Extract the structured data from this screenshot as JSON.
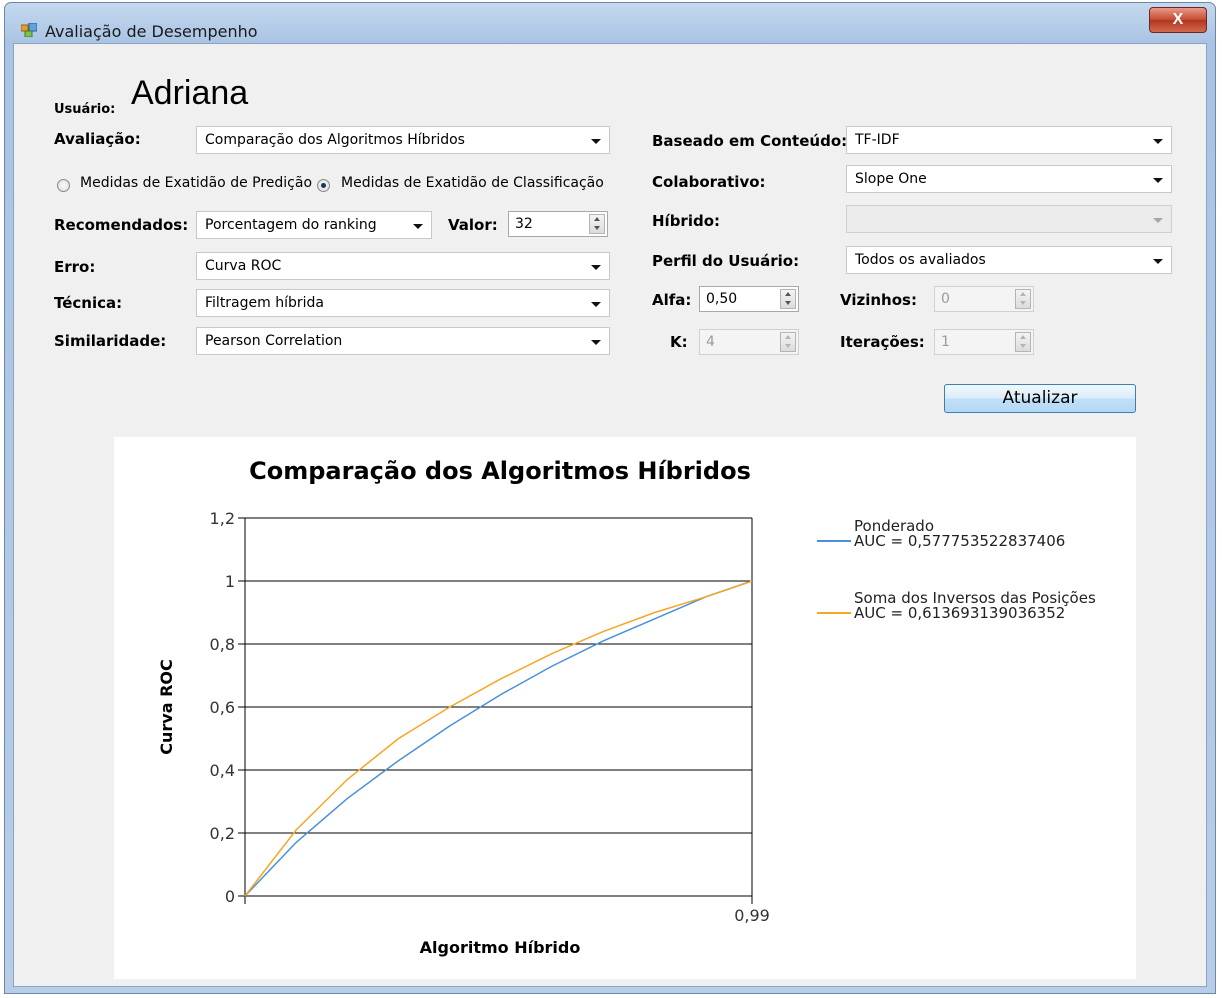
{
  "window": {
    "title": "Avaliação de Desempenho",
    "close_label": "X"
  },
  "user": {
    "label": "Usuário:",
    "name": "Adriana"
  },
  "left": {
    "avaliacao_label": "Avaliação:",
    "avaliacao_value": "Comparação dos Algoritmos Híbridos",
    "radio1_label": "Medidas de Exatidão de Predição",
    "radio2_label": "Medidas de Exatidão de Classificação",
    "recomendados_label": "Recomendados:",
    "recomendados_value": "Porcentagem do ranking",
    "valor_label": "Valor:",
    "valor_value": "32",
    "erro_label": "Erro:",
    "erro_value": "Curva ROC",
    "tecnica_label": "Técnica:",
    "tecnica_value": "Filtragem híbrida",
    "similaridade_label": "Similaridade:",
    "similaridade_value": "Pearson Correlation"
  },
  "right": {
    "conteudo_label": "Baseado em Conteúdo:",
    "conteudo_value": "TF-IDF",
    "colaborativo_label": "Colaborativo:",
    "colaborativo_value": "Slope One",
    "hibrido_label": "Híbrido:",
    "hibrido_value": "",
    "perfil_label": "Perfil do Usuário:",
    "perfil_value": "Todos os avaliados",
    "alfa_label": "Alfa:",
    "alfa_value": "0,50",
    "vizinhos_label": "Vizinhos:",
    "vizinhos_value": "0",
    "k_label": "K:",
    "k_value": "4",
    "iteracoes_label": "Iterações:",
    "iteracoes_value": "1",
    "atualizar_label": "Atualizar"
  },
  "chart_data": {
    "type": "line",
    "title": "Comparação dos Algoritmos Híbridos",
    "xlabel": "Algoritmo Híbrido",
    "ylabel": "Curva ROC",
    "xlim": [
      0,
      0.99
    ],
    "ylim": [
      0,
      1.2
    ],
    "x_tick_labels": [
      "0,99"
    ],
    "y_tick_labels": [
      "0",
      "0,2",
      "0,4",
      "0,6",
      "0,8",
      "1",
      "1,2"
    ],
    "grid": true,
    "legend_position": "right",
    "series": [
      {
        "name": "Ponderado",
        "auc_label": "AUC = 0,577753522837406",
        "color": "#4a90d9",
        "x": [
          0,
          0.1,
          0.2,
          0.3,
          0.4,
          0.5,
          0.6,
          0.7,
          0.8,
          0.9,
          0.99
        ],
        "y": [
          0,
          0.17,
          0.31,
          0.43,
          0.54,
          0.64,
          0.73,
          0.81,
          0.88,
          0.95,
          1.0
        ]
      },
      {
        "name": "Soma dos Inversos das Posições",
        "auc_label": "AUC = 0,613693139036352",
        "color": "#f5a623",
        "x": [
          0,
          0.1,
          0.2,
          0.3,
          0.4,
          0.5,
          0.6,
          0.7,
          0.8,
          0.9,
          0.99
        ],
        "y": [
          0,
          0.21,
          0.37,
          0.5,
          0.6,
          0.69,
          0.77,
          0.84,
          0.9,
          0.95,
          1.0
        ]
      }
    ]
  }
}
